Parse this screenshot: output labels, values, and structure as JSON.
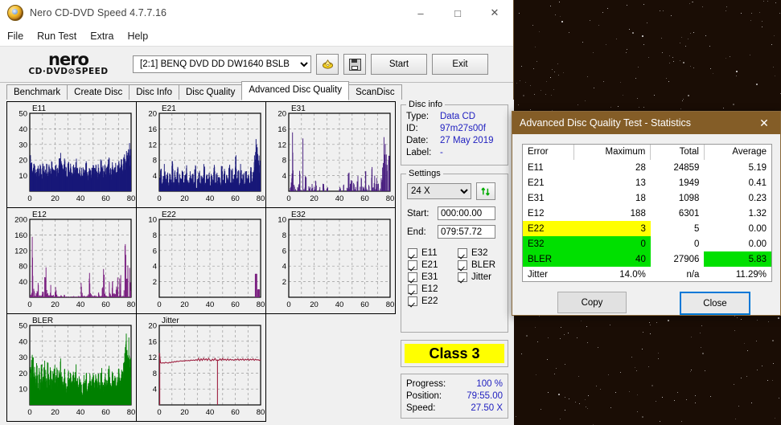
{
  "window": {
    "title": "Nero CD-DVD Speed 4.7.7.16",
    "icon": "nero-disc-icon",
    "minimize": "–",
    "maximize": "□",
    "close": "✕",
    "menus": [
      "File",
      "Run Test",
      "Extra",
      "Help"
    ],
    "logo_line1": "nero",
    "logo_line2": "CD·DVD⊘SPEED"
  },
  "toolbar": {
    "drive_selected": "[2:1]   BENQ DVD DD DW1640 BSLB",
    "drive_options": [
      "[2:1]   BENQ DVD DD DW1640 BSLB"
    ],
    "eject_icon": "eject-disc-icon",
    "save_icon": "save-floppy-icon",
    "start_label": "Start",
    "exit_label": "Exit"
  },
  "tabs": [
    {
      "label": "Benchmark",
      "active": false
    },
    {
      "label": "Create Disc",
      "active": false
    },
    {
      "label": "Disc Info",
      "active": false
    },
    {
      "label": "Disc Quality",
      "active": false
    },
    {
      "label": "Advanced Disc Quality",
      "active": true
    },
    {
      "label": "ScanDisc",
      "active": false
    }
  ],
  "disc_info": {
    "legend": "Disc info",
    "type_label": "Type:",
    "type_value": "Data CD",
    "id_label": "ID:",
    "id_value": "97m27s00f",
    "date_label": "Date:",
    "date_value": "27 May 2019",
    "label_label": "Label:",
    "label_value": "-"
  },
  "settings": {
    "legend": "Settings",
    "speed_selected": "24 X",
    "speed_options": [
      "24 X"
    ],
    "refresh_icon": "refresh-arrows-icon",
    "start_label": "Start:",
    "start_value": "000:00.00",
    "end_label": "End:",
    "end_value": "079:57.72",
    "checkboxes_col1": [
      "E11",
      "E21",
      "E31",
      "E12",
      "E22"
    ],
    "checkboxes_col2": [
      "E32",
      "BLER",
      "Jitter"
    ]
  },
  "class_badge": {
    "label": "Class 3",
    "color": "#ffff00"
  },
  "progress": {
    "progress_label": "Progress:",
    "progress_value": "100 %",
    "position_label": "Position:",
    "position_value": "79:55.00",
    "speed_label": "Speed:",
    "speed_value": "27.50 X"
  },
  "dialog": {
    "title": "Advanced Disc Quality Test - Statistics",
    "close_icon": "close-icon",
    "columns": [
      "Error",
      "Maximum",
      "Total",
      "Average"
    ],
    "rows": [
      {
        "error": "E11",
        "maximum": "28",
        "total": "24859",
        "average": "5.19",
        "hl": "none"
      },
      {
        "error": "E21",
        "maximum": "13",
        "total": "1949",
        "average": "0.41",
        "hl": "none"
      },
      {
        "error": "E31",
        "maximum": "18",
        "total": "1098",
        "average": "0.23",
        "hl": "none"
      },
      {
        "error": "E12",
        "maximum": "188",
        "total": "6301",
        "average": "1.32",
        "hl": "none"
      },
      {
        "error": "E22",
        "maximum": "3",
        "total": "5",
        "average": "0.00",
        "hl": "yellow"
      },
      {
        "error": "E32",
        "maximum": "0",
        "total": "0",
        "average": "0.00",
        "hl": "green"
      },
      {
        "error": "BLER",
        "maximum": "40",
        "total": "27906",
        "average": "5.83",
        "hl": "green-avg"
      },
      {
        "error": "Jitter",
        "maximum": "14.0%",
        "total": "n/a",
        "average": "11.29%",
        "hl": "none"
      }
    ],
    "copy_label": "Copy",
    "close_label": "Close",
    "highlight_yellow": "#ffff00",
    "highlight_green": "#00e000"
  },
  "chart_data": [
    {
      "type": "area",
      "title": "E11",
      "color": "#181878",
      "xlabel": "",
      "ylabel": "",
      "xlim": [
        0,
        80
      ],
      "ylim": [
        0,
        50
      ],
      "xticks": [
        0,
        20,
        40,
        60,
        80
      ],
      "yticks": [
        10,
        20,
        30,
        40,
        50
      ],
      "grid": true,
      "x": [
        0,
        1,
        2,
        3,
        4,
        5,
        6,
        7,
        8,
        9,
        10,
        11,
        12,
        13,
        14,
        15,
        16,
        17,
        18,
        19,
        20,
        21,
        22,
        23,
        24,
        25,
        26,
        27,
        28,
        29,
        30,
        31,
        32,
        33,
        34,
        35,
        36,
        37,
        38,
        39,
        40,
        41,
        42,
        43,
        44,
        45,
        46,
        47,
        48,
        49,
        50,
        51,
        52,
        53,
        54,
        55,
        56,
        57,
        58,
        59,
        60,
        61,
        62,
        63,
        64,
        65,
        66,
        67,
        68,
        69,
        70,
        71,
        72,
        73,
        74,
        75,
        76,
        77,
        78,
        79,
        80
      ],
      "values": [
        20,
        16,
        13,
        18,
        14,
        12,
        17,
        13,
        15,
        11,
        16,
        14,
        13,
        17,
        12,
        15,
        13,
        18,
        14,
        12,
        16,
        13,
        15,
        19,
        24,
        16,
        13,
        18,
        14,
        11,
        17,
        13,
        16,
        12,
        15,
        13,
        18,
        14,
        11,
        16,
        13,
        10,
        15,
        12,
        17,
        13,
        11,
        16,
        12,
        14,
        17,
        13,
        16,
        12,
        15,
        13,
        18,
        14,
        12,
        16,
        13,
        15,
        20,
        14,
        12,
        17,
        13,
        16,
        12,
        15,
        18,
        14,
        20,
        16,
        22,
        18,
        25,
        22,
        27,
        24,
        19
      ]
    },
    {
      "type": "area",
      "title": "E21",
      "color": "#181878",
      "xlabel": "",
      "ylabel": "",
      "xlim": [
        0,
        80
      ],
      "ylim": [
        0,
        20
      ],
      "xticks": [
        0,
        20,
        40,
        60,
        80
      ],
      "yticks": [
        4,
        8,
        12,
        16,
        20
      ],
      "grid": true,
      "x": [
        0,
        1,
        2,
        3,
        4,
        5,
        6,
        7,
        8,
        9,
        10,
        11,
        12,
        13,
        14,
        15,
        16,
        17,
        18,
        19,
        20,
        21,
        22,
        23,
        24,
        25,
        26,
        27,
        28,
        29,
        30,
        31,
        32,
        33,
        34,
        35,
        36,
        37,
        38,
        39,
        40,
        41,
        42,
        43,
        44,
        45,
        46,
        47,
        48,
        49,
        50,
        51,
        52,
        53,
        54,
        55,
        56,
        57,
        58,
        59,
        60,
        61,
        62,
        63,
        64,
        65,
        66,
        67,
        68,
        69,
        70,
        71,
        72,
        73,
        74,
        75,
        76,
        77,
        78,
        79,
        80
      ],
      "values": [
        3,
        5,
        2,
        4,
        6,
        3,
        5,
        2,
        4,
        3,
        7,
        2,
        5,
        3,
        6,
        2,
        4,
        3,
        5,
        2,
        4,
        6,
        3,
        2,
        5,
        3,
        4,
        2,
        6,
        1,
        3,
        5,
        2,
        4,
        3,
        6,
        2,
        4,
        3,
        5,
        2,
        4,
        3,
        6,
        2,
        5,
        3,
        4,
        2,
        6,
        3,
        5,
        2,
        4,
        3,
        7,
        2,
        5,
        3,
        4,
        8,
        3,
        5,
        2,
        6,
        3,
        4,
        2,
        5,
        3,
        4,
        2,
        6,
        3,
        5,
        8,
        13,
        10,
        8,
        7,
        4
      ]
    },
    {
      "type": "area",
      "title": "E31",
      "color": "#4a2080",
      "xlabel": "",
      "ylabel": "",
      "xlim": [
        0,
        80
      ],
      "ylim": [
        0,
        20
      ],
      "xticks": [
        0,
        20,
        40,
        60,
        80
      ],
      "yticks": [
        4,
        8,
        12,
        16,
        20
      ],
      "grid": true,
      "x": [
        0,
        1,
        2,
        3,
        4,
        5,
        6,
        7,
        8,
        9,
        10,
        11,
        12,
        13,
        14,
        15,
        16,
        17,
        18,
        19,
        20,
        21,
        22,
        23,
        24,
        25,
        26,
        27,
        28,
        29,
        30,
        31,
        32,
        33,
        34,
        35,
        36,
        37,
        38,
        39,
        40,
        41,
        42,
        43,
        44,
        45,
        46,
        47,
        48,
        49,
        50,
        51,
        52,
        53,
        54,
        55,
        56,
        57,
        58,
        59,
        60,
        61,
        62,
        63,
        64,
        65,
        66,
        67,
        68,
        69,
        70,
        71,
        72,
        73,
        74,
        75,
        76,
        77,
        78,
        79,
        80
      ],
      "values": [
        0,
        1,
        4,
        18,
        3,
        1,
        0,
        2,
        5,
        1,
        0,
        14,
        1,
        4,
        0,
        3,
        1,
        0,
        2,
        0,
        1,
        4,
        0,
        0,
        1,
        0,
        0,
        2,
        0,
        0,
        1,
        0,
        0,
        0,
        1,
        0,
        0,
        0,
        0,
        0,
        1,
        0,
        0,
        2,
        0,
        0,
        1,
        5,
        2,
        3,
        8,
        2,
        1,
        0,
        4,
        0,
        2,
        8,
        3,
        1,
        8,
        1,
        0,
        2,
        0,
        6,
        1,
        4,
        1,
        3,
        2,
        0,
        1,
        4,
        8,
        15,
        12,
        9,
        10,
        12,
        2
      ]
    },
    {
      "type": "area",
      "title": "E12",
      "color": "#7a2080",
      "xlabel": "",
      "ylabel": "",
      "xlim": [
        0,
        80
      ],
      "ylim": [
        0,
        200
      ],
      "xticks": [
        0,
        20,
        40,
        60,
        80
      ],
      "yticks": [
        40,
        80,
        120,
        160,
        200
      ],
      "grid": true,
      "x": [
        0,
        1,
        2,
        3,
        4,
        5,
        6,
        7,
        8,
        9,
        10,
        11,
        12,
        13,
        14,
        15,
        16,
        17,
        18,
        19,
        20,
        21,
        22,
        23,
        24,
        25,
        26,
        27,
        28,
        29,
        30,
        31,
        32,
        33,
        34,
        35,
        36,
        37,
        38,
        39,
        40,
        41,
        42,
        43,
        44,
        45,
        46,
        47,
        48,
        49,
        50,
        51,
        52,
        53,
        54,
        55,
        56,
        57,
        58,
        59,
        60,
        61,
        62,
        63,
        64,
        65,
        66,
        67,
        68,
        69,
        70,
        71,
        72,
        73,
        74,
        75,
        76,
        77,
        78,
        79,
        80
      ],
      "values": [
        5,
        10,
        185,
        40,
        8,
        20,
        35,
        12,
        5,
        8,
        15,
        124,
        70,
        20,
        10,
        8,
        30,
        5,
        6,
        12,
        25,
        8,
        3,
        2,
        5,
        3,
        2,
        6,
        2,
        1,
        3,
        2,
        1,
        2,
        4,
        1,
        2,
        1,
        3,
        2,
        68,
        10,
        3,
        6,
        2,
        4,
        8,
        62,
        10,
        5,
        3,
        8,
        4,
        2,
        12,
        3,
        6,
        30,
        70,
        8,
        4,
        60,
        84,
        10,
        6,
        40,
        15,
        8,
        25,
        55,
        12,
        60,
        8,
        5,
        20,
        122,
        62,
        90,
        135,
        70,
        16
      ]
    },
    {
      "type": "area",
      "title": "E22",
      "color": "#7a2080",
      "xlabel": "",
      "ylabel": "",
      "xlim": [
        0,
        80
      ],
      "ylim": [
        0,
        10
      ],
      "xticks": [
        0,
        20,
        40,
        60,
        80
      ],
      "yticks": [
        2,
        4,
        6,
        8,
        10
      ],
      "grid": true,
      "x": [
        75,
        76,
        77,
        78
      ],
      "values": [
        0,
        3,
        0,
        1
      ]
    },
    {
      "type": "area",
      "title": "E32",
      "color": "#7a2080",
      "xlabel": "",
      "ylabel": "",
      "xlim": [
        0,
        80
      ],
      "ylim": [
        0,
        10
      ],
      "xticks": [
        0,
        20,
        40,
        60,
        80
      ],
      "yticks": [
        2,
        4,
        6,
        8,
        10
      ],
      "grid": true,
      "x": [],
      "values": []
    },
    {
      "type": "area",
      "title": "BLER",
      "color": "#008000",
      "xlabel": "",
      "ylabel": "",
      "xlim": [
        0,
        80
      ],
      "ylim": [
        0,
        50
      ],
      "xticks": [
        0,
        20,
        40,
        60,
        80
      ],
      "yticks": [
        10,
        20,
        30,
        40,
        50
      ],
      "grid": true,
      "x": [
        0,
        1,
        2,
        3,
        4,
        5,
        6,
        7,
        8,
        9,
        10,
        11,
        12,
        13,
        14,
        15,
        16,
        17,
        18,
        19,
        20,
        21,
        22,
        23,
        24,
        25,
        26,
        27,
        28,
        29,
        30,
        31,
        32,
        33,
        34,
        35,
        36,
        37,
        38,
        39,
        40,
        41,
        42,
        43,
        44,
        45,
        46,
        47,
        48,
        49,
        50,
        51,
        52,
        53,
        54,
        55,
        56,
        57,
        58,
        59,
        60,
        61,
        62,
        63,
        64,
        65,
        66,
        67,
        68,
        69,
        70,
        71,
        72,
        73,
        74,
        75,
        76,
        77,
        78,
        79,
        80
      ],
      "values": [
        21,
        25,
        27,
        22,
        18,
        24,
        16,
        20,
        14,
        22,
        17,
        26,
        19,
        15,
        23,
        17,
        21,
        14,
        19,
        24,
        16,
        22,
        15,
        20,
        28,
        18,
        14,
        22,
        16,
        12,
        20,
        15,
        18,
        13,
        19,
        15,
        22,
        16,
        12,
        18,
        14,
        9,
        17,
        13,
        19,
        10,
        12,
        18,
        13,
        16,
        19,
        14,
        18,
        13,
        17,
        14,
        20,
        16,
        13,
        18,
        14,
        17,
        22,
        15,
        13,
        19,
        14,
        18,
        13,
        17,
        20,
        16,
        22,
        18,
        25,
        36,
        40,
        30,
        38,
        27,
        20
      ]
    },
    {
      "type": "line",
      "title": "Jitter",
      "color": "#9e2040",
      "xlabel": "",
      "ylabel": "",
      "xlim": [
        0,
        80
      ],
      "ylim": [
        0,
        20
      ],
      "xticks": [
        0,
        20,
        40,
        60,
        80
      ],
      "yticks": [
        4,
        8,
        12,
        16,
        20
      ],
      "grid": true,
      "x": [
        0,
        1,
        2,
        3,
        4,
        5,
        6,
        7,
        8,
        9,
        10,
        11,
        12,
        13,
        14,
        15,
        16,
        17,
        18,
        19,
        20,
        21,
        22,
        23,
        24,
        25,
        26,
        27,
        28,
        29,
        30,
        31,
        32,
        33,
        34,
        35,
        36,
        37,
        38,
        39,
        40,
        41,
        42,
        43,
        44,
        45,
        46,
        47,
        48,
        49,
        50,
        51,
        52,
        53,
        54,
        55,
        56,
        57,
        58,
        59,
        60,
        61,
        62,
        63,
        64,
        65,
        66,
        67,
        68,
        69,
        70,
        71,
        72,
        73,
        74,
        75,
        76,
        77,
        78,
        79,
        80
      ],
      "values": [
        13.0,
        10.6,
        10.5,
        10.6,
        10.5,
        10.7,
        10.6,
        10.5,
        10.7,
        10.6,
        10.8,
        10.7,
        10.9,
        10.8,
        11.0,
        10.9,
        11.0,
        11.1,
        11.0,
        11.1,
        11.0,
        11.2,
        11.1,
        11.2,
        11.1,
        11.3,
        11.2,
        11.3,
        11.2,
        11.4,
        11.2,
        11.7,
        11.1,
        11.6,
        11.2,
        11.7,
        11.3,
        11.6,
        11.2,
        11.7,
        11.3,
        11.1,
        11.5,
        11.2,
        11.7,
        11.2,
        11.3,
        11.2,
        11.6,
        11.2,
        11.7,
        11.3,
        11.5,
        11.2,
        11.6,
        11.2,
        11.5,
        11.3,
        11.4,
        11.2,
        11.5,
        11.3,
        11.6,
        11.2,
        11.5,
        11.3,
        11.6,
        11.2,
        11.5,
        11.3,
        11.6,
        11.2,
        11.5,
        11.3,
        11.6,
        11.2,
        11.5,
        11.3,
        11.4,
        11.2,
        11.4
      ],
      "annotations": [
        "vertical spike at x=0",
        "vertical spike at x=46"
      ]
    }
  ]
}
